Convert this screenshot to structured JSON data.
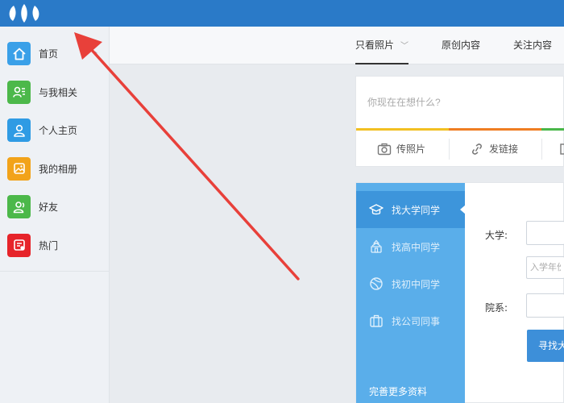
{
  "sidebar": {
    "items": [
      {
        "label": "首页",
        "icon": "home-icon",
        "color": "#3aa0e8"
      },
      {
        "label": "与我相关",
        "icon": "contact-card-icon",
        "color": "#4cb84a"
      },
      {
        "label": "个人主页",
        "icon": "person-icon",
        "color": "#2f9be4"
      },
      {
        "label": "我的相册",
        "icon": "photo-album-icon",
        "color": "#f2a31a"
      },
      {
        "label": "好友",
        "icon": "friends-icon",
        "color": "#4cb84a"
      },
      {
        "label": "热门",
        "icon": "hot-icon",
        "color": "#e6242a"
      }
    ]
  },
  "subnav": {
    "tabs": [
      {
        "label": "只看照片"
      },
      {
        "label": "原创内容"
      },
      {
        "label": "关注内容"
      }
    ]
  },
  "composer": {
    "placeholder": "你现在在想什么?",
    "actions": [
      {
        "label": "传照片",
        "icon": "camera-icon"
      },
      {
        "label": "发链接",
        "icon": "link-icon"
      }
    ],
    "bar_colors": [
      "#f2c022",
      "#ef7d22",
      "#49b749"
    ]
  },
  "finder": {
    "menu": [
      {
        "label": "找大学同学",
        "icon": "graduation-cap-icon"
      },
      {
        "label": "找高中同学",
        "icon": "building-icon"
      },
      {
        "label": "找初中同学",
        "icon": "ball-icon"
      },
      {
        "label": "找公司同事",
        "icon": "briefcase-icon"
      }
    ],
    "more": "完善更多资料",
    "form": {
      "university_label": "大学:",
      "year_placeholder": "入学年份",
      "department_label": "院系:",
      "search_button": "寻找大学同学"
    }
  },
  "colors": {
    "topbar": "#2a7ac8",
    "finder_menu": "#5aaeea",
    "finder_active": "#3d95db",
    "annotation_arrow": "#e8403a"
  }
}
